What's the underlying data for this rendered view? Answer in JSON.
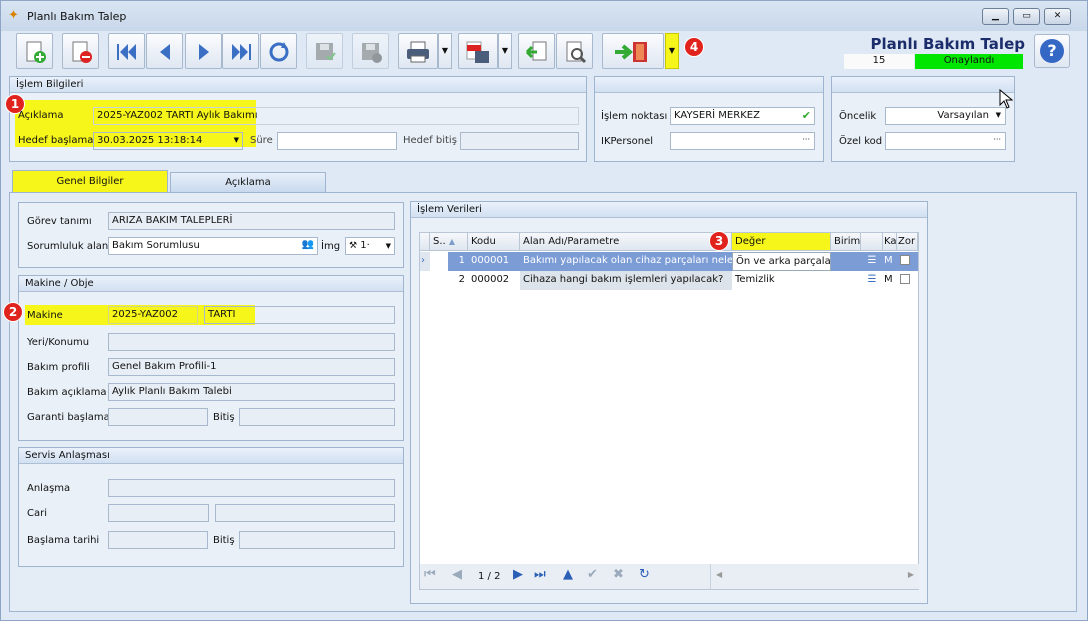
{
  "window": {
    "title": "Planlı Bakım Talep"
  },
  "header": {
    "title": "Planlı Bakım Talep",
    "number": "15",
    "status": "Onaylandı",
    "status_color": "#00e600"
  },
  "badges": [
    "1",
    "2",
    "3",
    "4"
  ],
  "islem_bilgileri": {
    "title": "İşlem Bilgileri",
    "aciklama_label": "Açıklama",
    "aciklama_value": "2025-YAZ002 TARTI Aylık Bakımı",
    "hedef_baslama_label": "Hedef başlama",
    "hedef_baslama_value": "30.03.2025 13:18:14",
    "sure_label": "Süre",
    "sure_value": "",
    "hedef_bitis_label": "Hedef bitiş",
    "hedef_bitis_value": ""
  },
  "islem_noktasi": {
    "label": "İşlem noktası",
    "value": "KAYSERİ MERKEZ",
    "ikpersonel_label": "IKPersonel",
    "ikpersonel_value": "",
    "ellipsis": "···"
  },
  "oncelik": {
    "label": "Öncelik",
    "value": "Varsayılan",
    "ozel_kod_label": "Özel kod",
    "ozel_kod_value": "",
    "ellipsis": "···"
  },
  "tabs": [
    {
      "label": "Genel Bilgiler"
    },
    {
      "label": "Açıklama"
    }
  ],
  "gorev": {
    "gorev_tanimi_label": "Görev tanımı",
    "gorev_tanimi_value": "ARIZA BAKIM TALEPLERİ",
    "sorumluluk_label": "Sorumluluk alanı",
    "sorumluluk_value": "Bakım Sorumlusu",
    "img_label": "İmg",
    "img_value": "1·"
  },
  "makine_obje": {
    "title": "Makine / Obje",
    "makine_label": "Makine",
    "makine_code": "2025-YAZ002",
    "makine_name": "TARTI",
    "yeri_label": "Yeri/Konumu",
    "yeri_value": "",
    "bakim_profili_label": "Bakım profili",
    "bakim_profili_value": "Genel Bakım Profili-1",
    "bakim_aciklama_label": "Bakım açıklama",
    "bakim_aciklama_value": "Aylık Planlı Bakım Talebi",
    "garanti_label": "Garanti başlama",
    "garanti_value": "",
    "bitis_label": "Bitiş",
    "bitis_value": ""
  },
  "servis": {
    "title": "Servis Anlaşması",
    "anlasma_label": "Anlaşma",
    "cari_label": "Cari",
    "baslama_label": "Başlama tarihi",
    "bitis_label": "Bitiş"
  },
  "islem_verileri": {
    "title": "İşlem Verileri",
    "columns": [
      "S..",
      "Kodu",
      "Alan Adı/Parametre",
      "Değer",
      "Birim",
      "Ka",
      "Zor"
    ],
    "rows": [
      {
        "s": "1",
        "kodu": "000001",
        "alan": "Bakımı yapılacak olan cihaz parçaları neler?",
        "deger": "Ön ve arka parçalar",
        "ka": "M"
      },
      {
        "s": "2",
        "kodu": "000002",
        "alan": "Cihaza hangi bakım işlemleri yapılacak?",
        "deger": "Temizlik",
        "ka": "M"
      }
    ],
    "pager": "1 / 2"
  }
}
